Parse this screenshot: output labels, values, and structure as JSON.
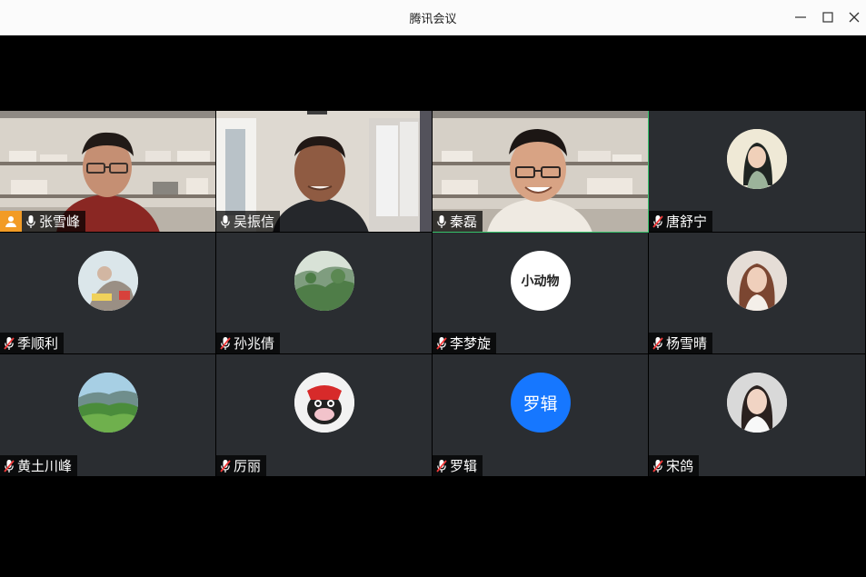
{
  "window": {
    "title": "腾讯会议"
  },
  "colors": {
    "tile_bg": "#2a2d31",
    "active_speaker": "#35c26a",
    "host_badge": "#f29b25",
    "blue_avatar": "#1677ff"
  },
  "participants": [
    {
      "name": "张雪峰",
      "mic": "on",
      "video": "on",
      "host": true
    },
    {
      "name": "吴振信",
      "mic": "on",
      "video": "on"
    },
    {
      "name": "秦磊",
      "mic": "on",
      "video": "on",
      "active": true
    },
    {
      "name": "唐舒宁",
      "mic": "muted",
      "avatar": "illustrated-woman-icon"
    },
    {
      "name": "季顺利",
      "mic": "muted",
      "avatar": "painting-icon"
    },
    {
      "name": "孙兆倩",
      "mic": "muted",
      "avatar": "landscape-icon"
    },
    {
      "name": "李梦旋",
      "mic": "muted",
      "avatar_text": "小动物"
    },
    {
      "name": "杨雪晴",
      "mic": "muted",
      "avatar": "woman-photo-icon"
    },
    {
      "name": "黄土川峰",
      "mic": "muted",
      "avatar": "green-hills-icon"
    },
    {
      "name": "厉丽",
      "mic": "muted",
      "avatar": "cartoon-ox-icon"
    },
    {
      "name": "罗辑",
      "mic": "muted",
      "avatar_text": "罗辑"
    },
    {
      "name": "宋鸽",
      "mic": "muted",
      "avatar": "girl-photo-icon"
    }
  ]
}
